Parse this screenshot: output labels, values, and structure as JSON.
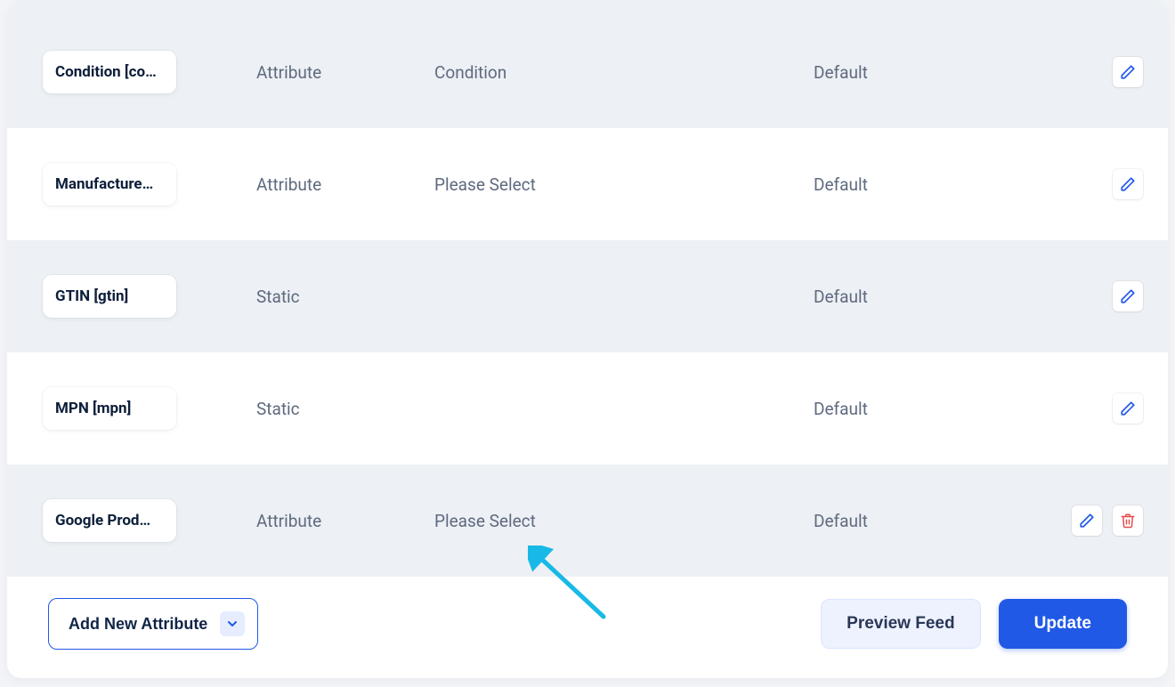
{
  "rows": [
    {
      "chip": "Condition [co…",
      "type": "Attribute",
      "value": "Condition",
      "scope": "Default",
      "deletable": false
    },
    {
      "chip": "Manufacture…",
      "type": "Attribute",
      "value": "Please Select",
      "scope": "Default",
      "deletable": false
    },
    {
      "chip": "GTIN [gtin]",
      "type": "Static",
      "value": "",
      "scope": "Default",
      "deletable": false
    },
    {
      "chip": "MPN [mpn]",
      "type": "Static",
      "value": "",
      "scope": "Default",
      "deletable": false
    },
    {
      "chip": "Google Prod…",
      "type": "Attribute",
      "value": "Please Select",
      "scope": "Default",
      "deletable": true
    }
  ],
  "footer": {
    "add_label": "Add New Attribute",
    "preview_label": "Preview Feed",
    "update_label": "Update"
  },
  "colors": {
    "primary": "#2059e6",
    "danger": "#e44c4c"
  }
}
